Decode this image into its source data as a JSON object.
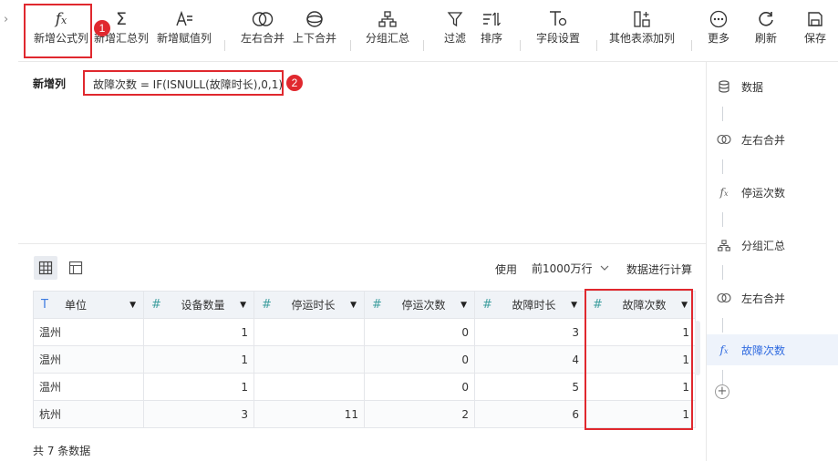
{
  "toolbar": {
    "items": [
      {
        "label": "新增公式列",
        "icon": "fx-icon"
      },
      {
        "label": "新增汇总列",
        "icon": "sigma-icon"
      },
      {
        "label": "新增赋值列",
        "icon": "assign-icon"
      },
      {
        "label": "左右合并",
        "icon": "merge-lr-icon"
      },
      {
        "label": "上下合并",
        "icon": "merge-ud-icon"
      },
      {
        "label": "分组汇总",
        "icon": "group-icon"
      },
      {
        "label": "过滤",
        "icon": "filter-icon"
      },
      {
        "label": "排序",
        "icon": "sort-icon"
      },
      {
        "label": "字段设置",
        "icon": "field-settings-icon"
      },
      {
        "label": "其他表添加列",
        "icon": "add-column-icon"
      },
      {
        "label": "更多",
        "icon": "more-icon"
      },
      {
        "label": "刷新",
        "icon": "refresh-icon"
      },
      {
        "label": "保存",
        "icon": "save-icon"
      }
    ]
  },
  "annotations": {
    "badge1": "1",
    "badge2": "2"
  },
  "formula": {
    "label": "新增列",
    "expression": "故障次数 = IF(ISNULL(故障时长),0,1)"
  },
  "preview": {
    "use_label": "使用",
    "rows_option": "前1000万行",
    "calc_label": "数据进行计算"
  },
  "table": {
    "columns": [
      {
        "name": "单位",
        "type": "text"
      },
      {
        "name": "设备数量",
        "type": "number"
      },
      {
        "name": "停运时长",
        "type": "number"
      },
      {
        "name": "停运次数",
        "type": "number"
      },
      {
        "name": "故障时长",
        "type": "number"
      },
      {
        "name": "故障次数",
        "type": "number"
      }
    ],
    "rows": [
      [
        "温州",
        "1",
        "",
        "0",
        "3",
        "1"
      ],
      [
        "温州",
        "1",
        "",
        "0",
        "4",
        "1"
      ],
      [
        "温州",
        "1",
        "",
        "0",
        "5",
        "1"
      ],
      [
        "杭州",
        "3",
        "11",
        "2",
        "6",
        "1"
      ]
    ],
    "footer": "共 7 条数据"
  },
  "sidebar": {
    "steps": [
      {
        "label": "数据",
        "icon": "database-icon"
      },
      {
        "label": "左右合并",
        "icon": "merge-lr-icon"
      },
      {
        "label": "停运次数",
        "icon": "fx-icon"
      },
      {
        "label": "分组汇总",
        "icon": "group-icon"
      },
      {
        "label": "左右合并",
        "icon": "merge-lr-icon"
      },
      {
        "label": "故障次数",
        "icon": "fx-icon"
      }
    ],
    "add_label": "+"
  },
  "colors": {
    "highlight": "#e0282e",
    "accent": "#2f6ae0",
    "header_bg": "#f0f3f7"
  }
}
